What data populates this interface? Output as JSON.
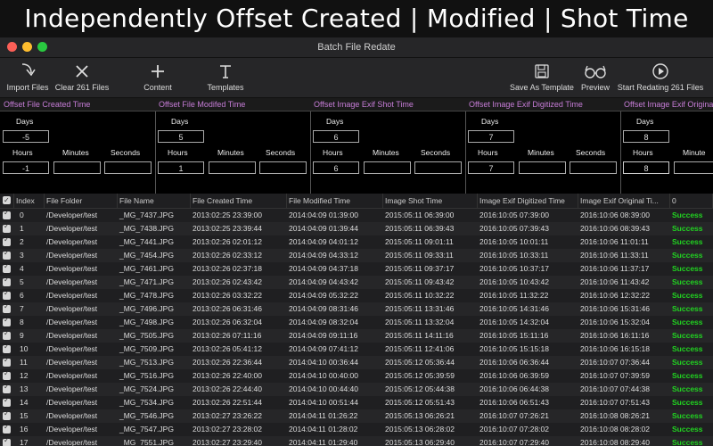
{
  "banner": "Independently Offset Created | Modified | Shot Time",
  "window_title": "Batch File Redate",
  "toolbar": {
    "import": "Import Files",
    "clear": "Clear 261 Files",
    "content": "Content",
    "templates": "Templates",
    "save_template": "Save As Template",
    "preview": "Preview",
    "start": "Start Redating 261 Files"
  },
  "panels": [
    {
      "title": "Offset File Created Time",
      "days": "-5",
      "hours": "-1",
      "minutes": "",
      "seconds": ""
    },
    {
      "title": "Offset File Modifed Time",
      "days": "5",
      "hours": "1",
      "minutes": "",
      "seconds": ""
    },
    {
      "title": "Offset Image Exif Shot Time",
      "days": "6",
      "hours": "6",
      "minutes": "",
      "seconds": ""
    },
    {
      "title": "Offset Image Exif Digitized Time",
      "days": "7",
      "hours": "7",
      "minutes": "",
      "seconds": ""
    },
    {
      "title": "Offset Image Exif Original Time",
      "days": "8",
      "hours": "8",
      "minutes": "",
      "seconds": ""
    }
  ],
  "panel_labels": {
    "days": "Days",
    "hours": "Hours",
    "minutes": "Minutes",
    "seconds": "Seconds"
  },
  "panel_last_minutes_label": "Minute",
  "columns": [
    "Index",
    "File Folder",
    "File Name",
    "File Created Time",
    "File Modified Time",
    "Image Shot Time",
    "Image Exif Digitized Time",
    "Image Exif Original Ti...",
    "0"
  ],
  "rows": [
    {
      "index": "0",
      "folder": "/Developer/test",
      "name": "_MG_7437.JPG",
      "created": "2013:02:25 23:39:00",
      "modified": "2014:04:09 01:39:00",
      "shot": "2015:05:11 06:39:00",
      "digitized": "2016:10:05 07:39:00",
      "original": "2016:10:06 08:39:00",
      "status": "Success"
    },
    {
      "index": "1",
      "folder": "/Developer/test",
      "name": "_MG_7438.JPG",
      "created": "2013:02:25 23:39:44",
      "modified": "2014:04:09 01:39:44",
      "shot": "2015:05:11 06:39:43",
      "digitized": "2016:10:05 07:39:43",
      "original": "2016:10:06 08:39:43",
      "status": "Success"
    },
    {
      "index": "2",
      "folder": "/Developer/test",
      "name": "_MG_7441.JPG",
      "created": "2013:02:26 02:01:12",
      "modified": "2014:04:09 04:01:12",
      "shot": "2015:05:11 09:01:11",
      "digitized": "2016:10:05 10:01:11",
      "original": "2016:10:06 11:01:11",
      "status": "Success"
    },
    {
      "index": "3",
      "folder": "/Developer/test",
      "name": "_MG_7454.JPG",
      "created": "2013:02:26 02:33:12",
      "modified": "2014:04:09 04:33:12",
      "shot": "2015:05:11 09:33:11",
      "digitized": "2016:10:05 10:33:11",
      "original": "2016:10:06 11:33:11",
      "status": "Success"
    },
    {
      "index": "4",
      "folder": "/Developer/test",
      "name": "_MG_7461.JPG",
      "created": "2013:02:26 02:37:18",
      "modified": "2014:04:09 04:37:18",
      "shot": "2015:05:11 09:37:17",
      "digitized": "2016:10:05 10:37:17",
      "original": "2016:10:06 11:37:17",
      "status": "Success"
    },
    {
      "index": "5",
      "folder": "/Developer/test",
      "name": "_MG_7471.JPG",
      "created": "2013:02:26 02:43:42",
      "modified": "2014:04:09 04:43:42",
      "shot": "2015:05:11 09:43:42",
      "digitized": "2016:10:05 10:43:42",
      "original": "2016:10:06 11:43:42",
      "status": "Success"
    },
    {
      "index": "6",
      "folder": "/Developer/test",
      "name": "_MG_7478.JPG",
      "created": "2013:02:26 03:32:22",
      "modified": "2014:04:09 05:32:22",
      "shot": "2015:05:11 10:32:22",
      "digitized": "2016:10:05 11:32:22",
      "original": "2016:10:06 12:32:22",
      "status": "Success"
    },
    {
      "index": "7",
      "folder": "/Developer/test",
      "name": "_MG_7496.JPG",
      "created": "2013:02:26 06:31:46",
      "modified": "2014:04:09 08:31:46",
      "shot": "2015:05:11 13:31:46",
      "digitized": "2016:10:05 14:31:46",
      "original": "2016:10:06 15:31:46",
      "status": "Success"
    },
    {
      "index": "8",
      "folder": "/Developer/test",
      "name": "_MG_7498.JPG",
      "created": "2013:02:26 06:32:04",
      "modified": "2014:04:09 08:32:04",
      "shot": "2015:05:11 13:32:04",
      "digitized": "2016:10:05 14:32:04",
      "original": "2016:10:06 15:32:04",
      "status": "Success"
    },
    {
      "index": "9",
      "folder": "/Developer/test",
      "name": "_MG_7505.JPG",
      "created": "2013:02:26 07:11:16",
      "modified": "2014:04:09 09:11:16",
      "shot": "2015:05:11 14:11:16",
      "digitized": "2016:10:05 15:11:16",
      "original": "2016:10:06 16:11:16",
      "status": "Success"
    },
    {
      "index": "10",
      "folder": "/Developer/test",
      "name": "_MG_7509.JPG",
      "created": "2013:02:26 05:41:12",
      "modified": "2014:04:09 07:41:12",
      "shot": "2015:05:11 12:41:06",
      "digitized": "2016:10:05 15:15:18",
      "original": "2016:10:06 16:15:18",
      "status": "Success"
    },
    {
      "index": "11",
      "folder": "/Developer/test",
      "name": "_MG_7513.JPG",
      "created": "2013:02:26 22:36:44",
      "modified": "2014:04:10 00:36:44",
      "shot": "2015:05:12 05:36:44",
      "digitized": "2016:10:06 06:36:44",
      "original": "2016:10:07 07:36:44",
      "status": "Success"
    },
    {
      "index": "12",
      "folder": "/Developer/test",
      "name": "_MG_7516.JPG",
      "created": "2013:02:26 22:40:00",
      "modified": "2014:04:10 00:40:00",
      "shot": "2015:05:12 05:39:59",
      "digitized": "2016:10:06 06:39:59",
      "original": "2016:10:07 07:39:59",
      "status": "Success"
    },
    {
      "index": "13",
      "folder": "/Developer/test",
      "name": "_MG_7524.JPG",
      "created": "2013:02:26 22:44:40",
      "modified": "2014:04:10 00:44:40",
      "shot": "2015:05:12 05:44:38",
      "digitized": "2016:10:06 06:44:38",
      "original": "2016:10:07 07:44:38",
      "status": "Success"
    },
    {
      "index": "14",
      "folder": "/Developer/test",
      "name": "_MG_7534.JPG",
      "created": "2013:02:26 22:51:44",
      "modified": "2014:04:10 00:51:44",
      "shot": "2015:05:12 05:51:43",
      "digitized": "2016:10:06 06:51:43",
      "original": "2016:10:07 07:51:43",
      "status": "Success"
    },
    {
      "index": "15",
      "folder": "/Developer/test",
      "name": "_MG_7546.JPG",
      "created": "2013:02:27 23:26:22",
      "modified": "2014:04:11 01:26:22",
      "shot": "2015:05:13 06:26:21",
      "digitized": "2016:10:07 07:26:21",
      "original": "2016:10:08 08:26:21",
      "status": "Success"
    },
    {
      "index": "16",
      "folder": "/Developer/test",
      "name": "_MG_7547.JPG",
      "created": "2013:02:27 23:28:02",
      "modified": "2014:04:11 01:28:02",
      "shot": "2015:05:13 06:28:02",
      "digitized": "2016:10:07 07:28:02",
      "original": "2016:10:08 08:28:02",
      "status": "Success"
    },
    {
      "index": "17",
      "folder": "/Developer/test",
      "name": "_MG_7551.JPG",
      "created": "2013:02:27 23:29:40",
      "modified": "2014:04:11 01:29:40",
      "shot": "2015:05:13 06:29:40",
      "digitized": "2016:10:07 07:29:40",
      "original": "2016:10:08 08:29:40",
      "status": "Success"
    }
  ]
}
